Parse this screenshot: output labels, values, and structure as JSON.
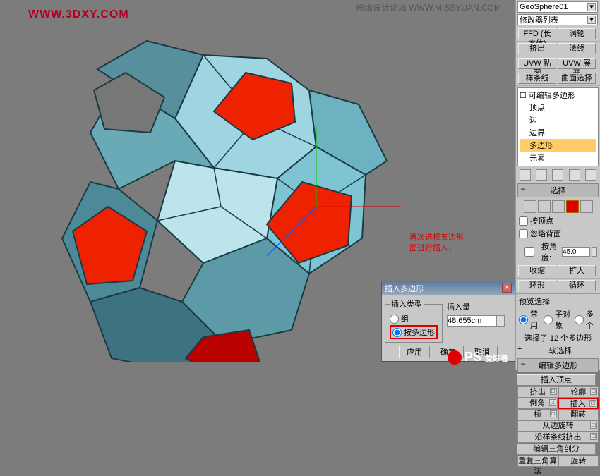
{
  "watermarks": {
    "url": "WWW.3DXY.COM",
    "top": "思缘设计论坛 WWW.MISSYUAN.COM",
    "bottom": "爱好者"
  },
  "annotation": {
    "line1": "再次选择五边形",
    "line2": "面进行插入，"
  },
  "panel": {
    "object_name": "GeoSphere01",
    "modifier_list": "修改器列表",
    "buttons": {
      "ffd": "FFD (长方体)",
      "turbo": "涡轮",
      "extrude": "挤出",
      "lathe": "法线",
      "uvw_map": "UVW 贴图",
      "uvw_unwrap": "UVW 展开",
      "spline": "样条线",
      "surface": "曲面选择"
    },
    "tree": {
      "root": "可编辑多边形",
      "vertex": "顶点",
      "edge": "边",
      "border": "边界",
      "polygon": "多边形",
      "element": "元素"
    },
    "section_select": "选择",
    "by_vertex": "按顶点",
    "ignore_backfacing": "忽略背面",
    "by_angle": "按角度:",
    "angle_val": "45.0",
    "shrink": "收缩",
    "grow": "扩大",
    "ring": "环形",
    "loop": "循环",
    "preview": "预览选择",
    "off": "禁用",
    "subobj": "子对象",
    "multi": "多个",
    "status": "选择了 12 个多边形",
    "soft_header": "软选择",
    "edit_poly_header": "编辑多边形",
    "insert_vertex": "插入顶点",
    "extrude_btn": "挤出",
    "outline_btn": "轮廓",
    "bevel_btn": "倒角",
    "inset_btn": "插入",
    "bridge_btn": "桥",
    "flip_btn": "翻转",
    "hinge": "从边旋转",
    "extrude_spline": "沿样条线挤出",
    "edit_tri": "编辑三角剖分",
    "retri": "重复三角算法",
    "turn": "旋转"
  },
  "dialog": {
    "title": "插入多边形",
    "type_label": "插入类型",
    "radio_group": "组",
    "radio_poly": "按多边形",
    "amount_label": "插入量",
    "amount_value": "48.655cm",
    "apply": "应用",
    "ok": "确定",
    "cancel": "取消"
  }
}
